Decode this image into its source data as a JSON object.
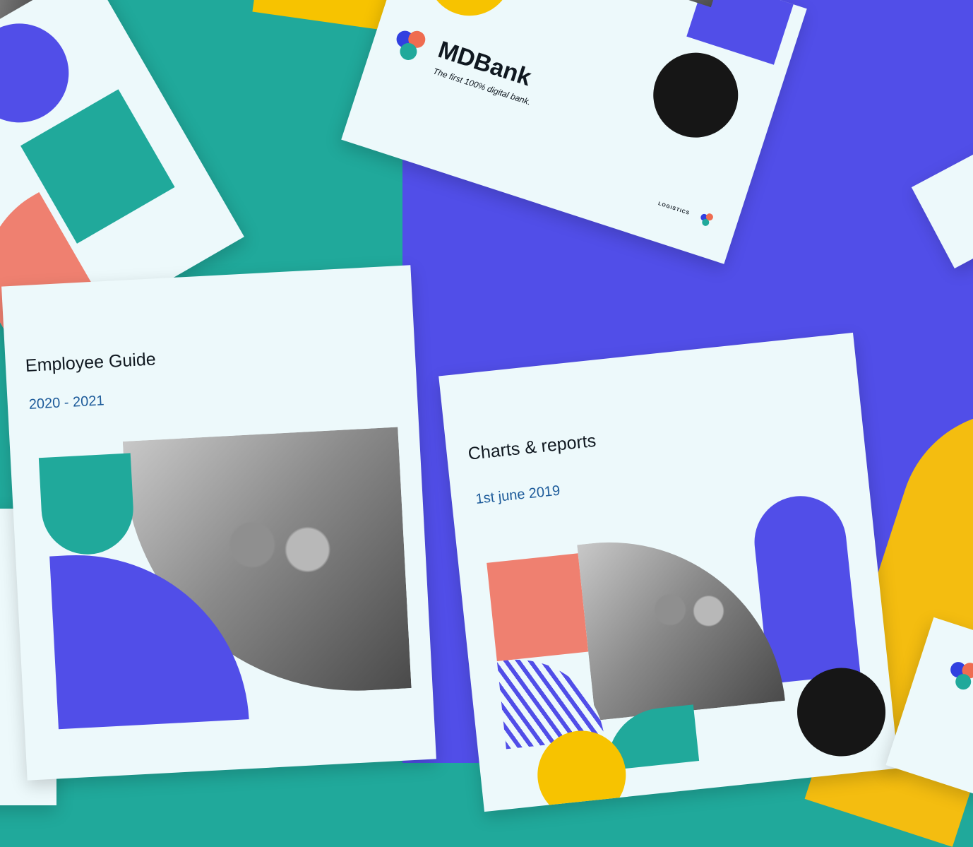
{
  "employee_guide": {
    "title": "Employee Guide",
    "years": "2020 - 2021"
  },
  "charts_report": {
    "title": "Charts & reports",
    "date": "1st june 2019"
  },
  "brand_card": {
    "name": "MDBank",
    "tagline": "The first 100% digital bank.",
    "footer_label": "LOGISTICS"
  },
  "colors": {
    "teal": "#20a99b",
    "purple": "#514ee8",
    "yellow": "#f7c300",
    "coral": "#ef8070",
    "black": "#161616",
    "paper": "#edf9fb",
    "navy": "#101820",
    "blue_text": "#1d5b9a"
  },
  "icons": [
    "mdbank-logo-icon"
  ]
}
